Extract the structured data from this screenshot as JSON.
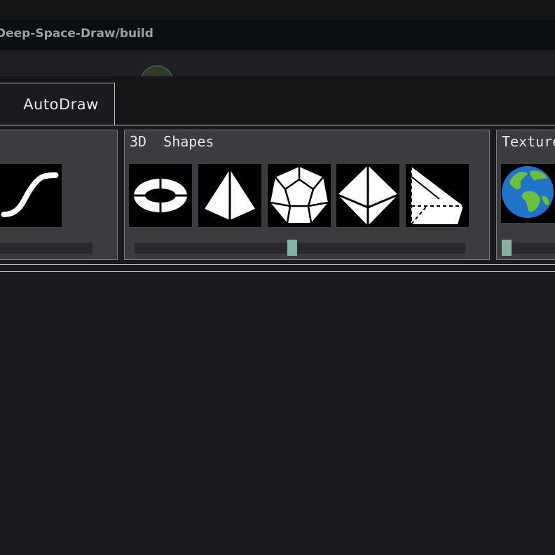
{
  "window": {
    "title": "Deep-Space-Draw/build"
  },
  "tabs": [
    {
      "label": "AutoDraw"
    }
  ],
  "groups": {
    "left": {
      "title": "",
      "slider_value": 0
    },
    "shapes3d": {
      "title": "3D  Shapes",
      "items": [
        {
          "icon": "torus-icon"
        },
        {
          "icon": "pyramid-icon"
        },
        {
          "icon": "dodecahedron-icon"
        },
        {
          "icon": "octahedron-icon"
        },
        {
          "icon": "prism-icon"
        }
      ],
      "slider_value": 0.5
    },
    "textures": {
      "title": "Textures",
      "items": [
        {
          "icon": "earth-icon"
        }
      ],
      "slider_value": 0
    }
  },
  "colors": {
    "background": "#1b1b1f",
    "panel": "#3b3b40",
    "slider_thumb": "#84b2a3",
    "tile": "#000000"
  }
}
